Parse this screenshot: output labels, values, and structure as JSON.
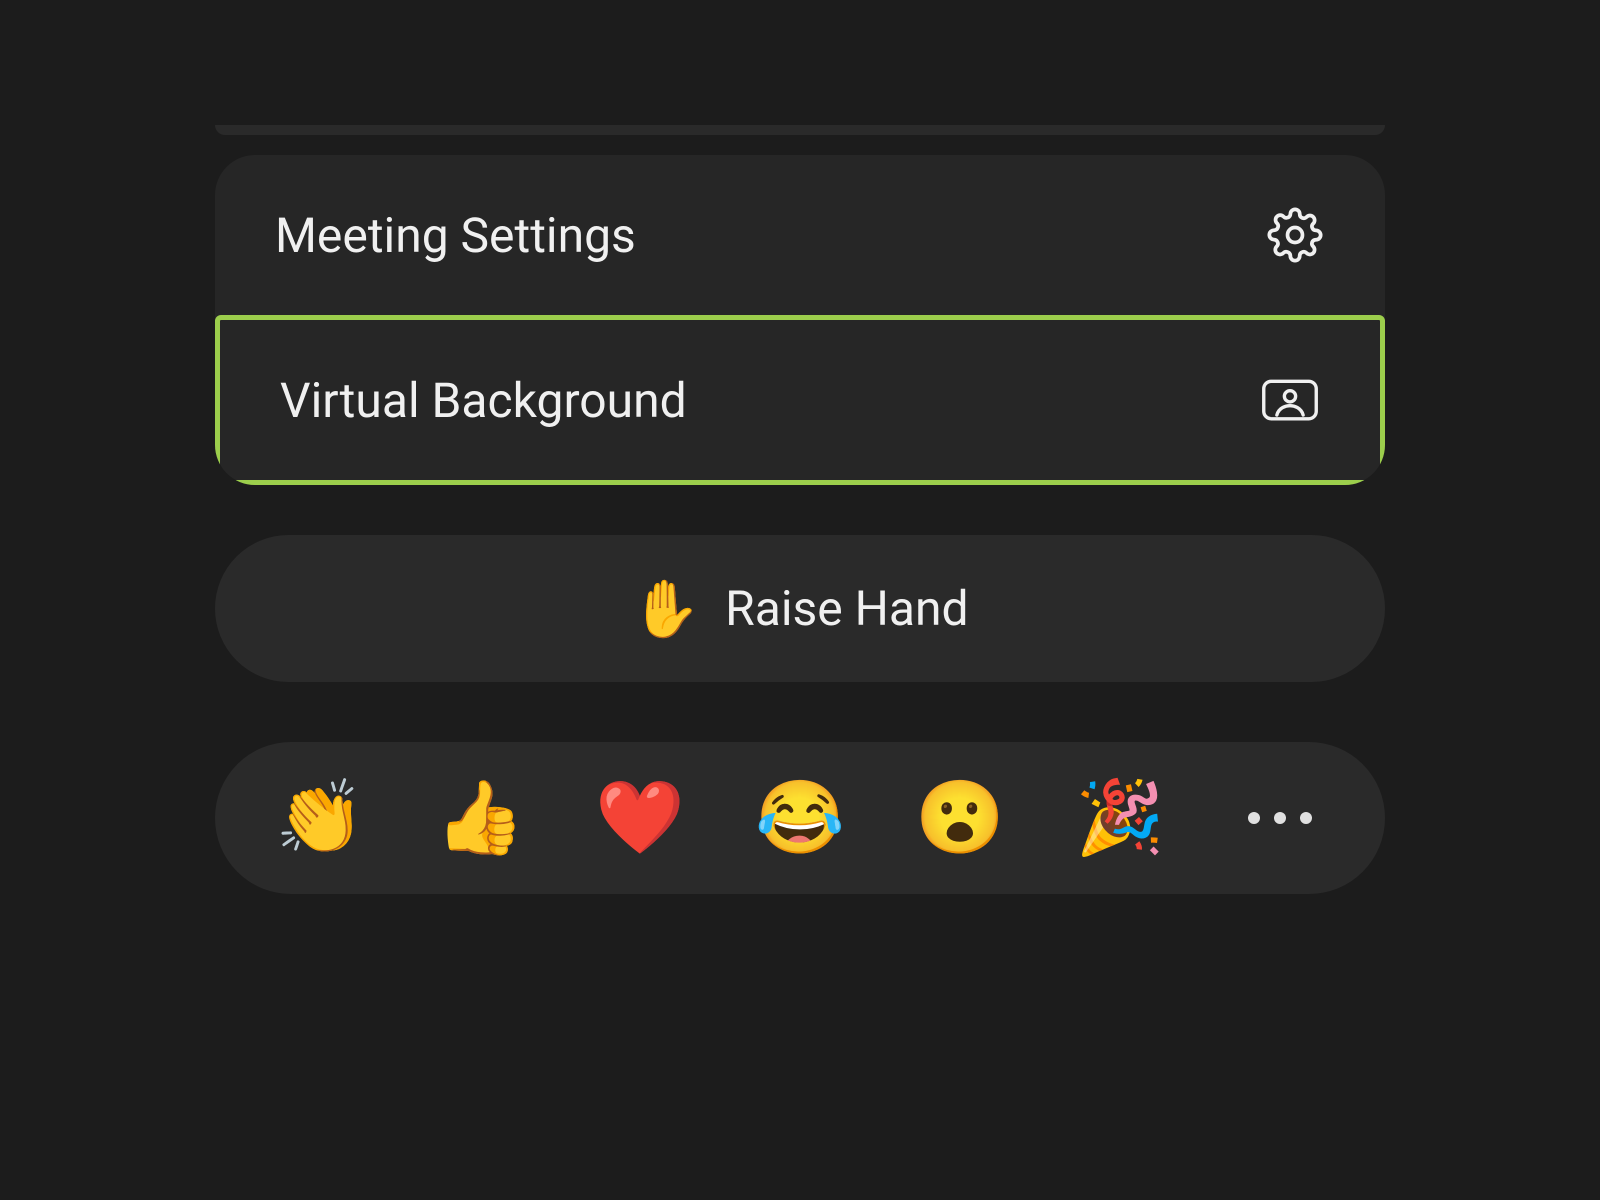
{
  "menu": {
    "meeting_settings": {
      "label": "Meeting Settings"
    },
    "virtual_background": {
      "label": "Virtual Background"
    }
  },
  "raise_hand": {
    "label": "Raise Hand",
    "emoji": "✋"
  },
  "reactions": [
    {
      "name": "clap",
      "emoji": "👏"
    },
    {
      "name": "thumbs",
      "emoji": "👍"
    },
    {
      "name": "heart",
      "emoji": "❤️"
    },
    {
      "name": "joy",
      "emoji": "😂"
    },
    {
      "name": "wow",
      "emoji": "😮"
    },
    {
      "name": "party",
      "emoji": "🎉"
    }
  ],
  "colors": {
    "highlight": "#9cce4c",
    "bg": "#1c1c1c",
    "panel": "#262626"
  }
}
